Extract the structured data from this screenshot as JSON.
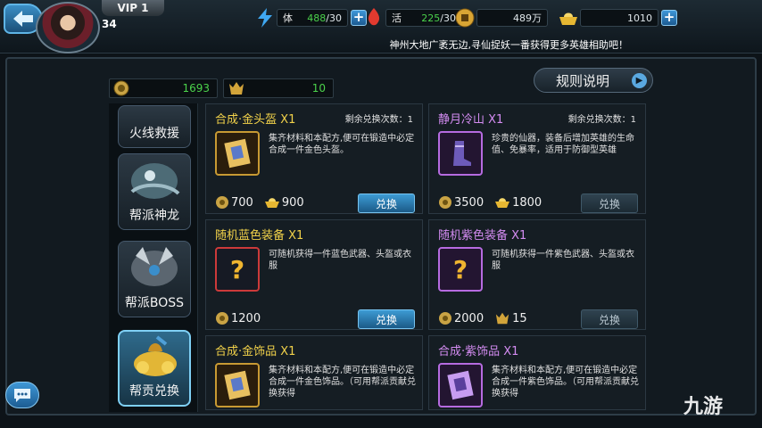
{
  "header": {
    "vip": "VIP 1",
    "level": "34",
    "stamina": {
      "label": "体",
      "value": "488",
      "max": "/30"
    },
    "vitality": {
      "label": "活",
      "value": "225",
      "max": "/30"
    },
    "coins": "489万",
    "gold": "1010",
    "notice": "神州大地广袤无边,寻仙捉妖一番获得更多英雄相助吧！"
  },
  "stats": {
    "contribution": "1693",
    "boss_token": "10"
  },
  "rules_button": "规则说明",
  "sidebar": {
    "items": [
      {
        "label": "火线救援"
      },
      {
        "label": "帮派神龙"
      },
      {
        "label": "帮派BOSS"
      },
      {
        "label": "帮贡兑换"
      }
    ]
  },
  "cards": [
    {
      "title": "合成·金头盔 X1",
      "remain": "剩余兑换次数：1",
      "desc": "集齐材料和本配方,便可在锻造中必定合成一件金色头盔。",
      "cost1": "700",
      "cost2": "900",
      "button": "兑换"
    },
    {
      "title": "静月冷山 X1",
      "remain": "剩余兑换次数：1",
      "desc": "珍贵的仙器，装备后增加英雄的生命值、免暴率，适用于防御型英雄",
      "cost1": "3500",
      "cost2": "1800",
      "button": "兑换"
    },
    {
      "title": "随机蓝色装备 X1",
      "desc": "可随机获得一件蓝色武器、头盔或衣服",
      "cost1": "1200",
      "button": "兑换"
    },
    {
      "title": "随机紫色装备 X1",
      "desc": "可随机获得一件紫色武器、头盔或衣服",
      "cost1": "2000",
      "cost2": "15",
      "button": "兑换"
    },
    {
      "title": "合成·金饰品 X1",
      "desc": "集齐材料和本配方,便可在锻造中必定合成一件金色饰品。（可用帮派贡献兑换获得"
    },
    {
      "title": "合成·紫饰品 X1",
      "desc": "集齐材料和本配方,便可在锻造中必定合成一件紫色饰品。（可用帮派贡献兑换获得"
    }
  ],
  "watermark": "九游",
  "colors": {
    "gold_title": "#f2d24a",
    "purple_title": "#d48cf2",
    "stat_green": "#4bd24b",
    "accent_blue": "#3d9bd4"
  }
}
